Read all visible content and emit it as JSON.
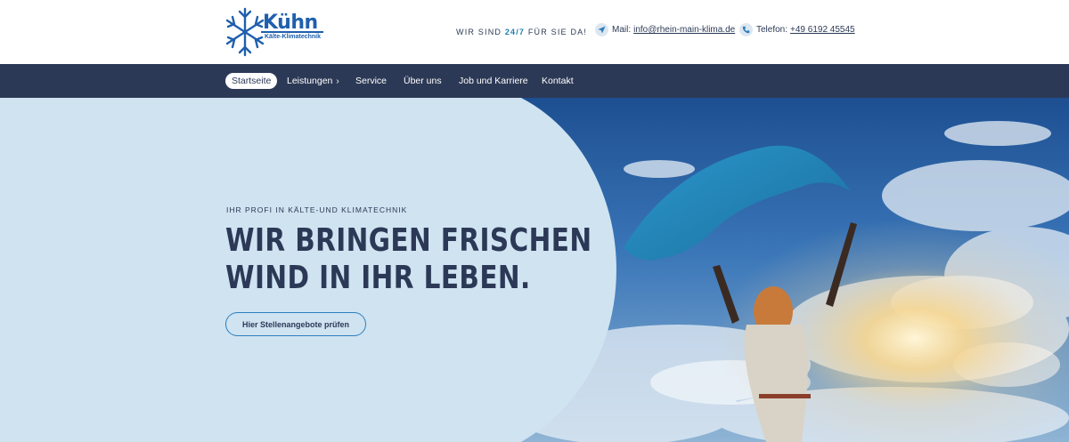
{
  "header": {
    "logo": {
      "name": "Kühn",
      "subtitle": "Kälte-Klimatechnik"
    },
    "tagline": {
      "before": "WIR SIND ",
      "highlight": "24/7",
      "after": " FÜR SIE DA!"
    },
    "mail": {
      "label": "Mail:",
      "value": "info@rhein-main-klima.de",
      "icon": "send-icon"
    },
    "phone": {
      "label": "Telefon:",
      "value": "+49 6192 45545",
      "icon": "phone-icon"
    }
  },
  "nav": {
    "items": [
      {
        "label": "Startseite",
        "active": true
      },
      {
        "label": "Leistungen",
        "has_submenu": true,
        "chevron": "›"
      },
      {
        "label": "Service"
      },
      {
        "label": "Über uns"
      },
      {
        "label": "Job und Karriere"
      },
      {
        "label": "Kontakt"
      }
    ]
  },
  "hero": {
    "kicker": "IHR PROFI IN KÄLTE-UND KLIMATECHNIK",
    "headline_line1": "WIR BRINGEN FRISCHEN",
    "headline_line2": "WIND IN IHR LEBEN.",
    "cta_label": "Hier Stellenangebote prüfen"
  },
  "colors": {
    "brand_blue": "#1f5fad",
    "nav_bg": "#2c3956",
    "hero_panel": "#cfe3f1",
    "accent": "#1f7fae",
    "cta_border": "#2d7fbd"
  }
}
